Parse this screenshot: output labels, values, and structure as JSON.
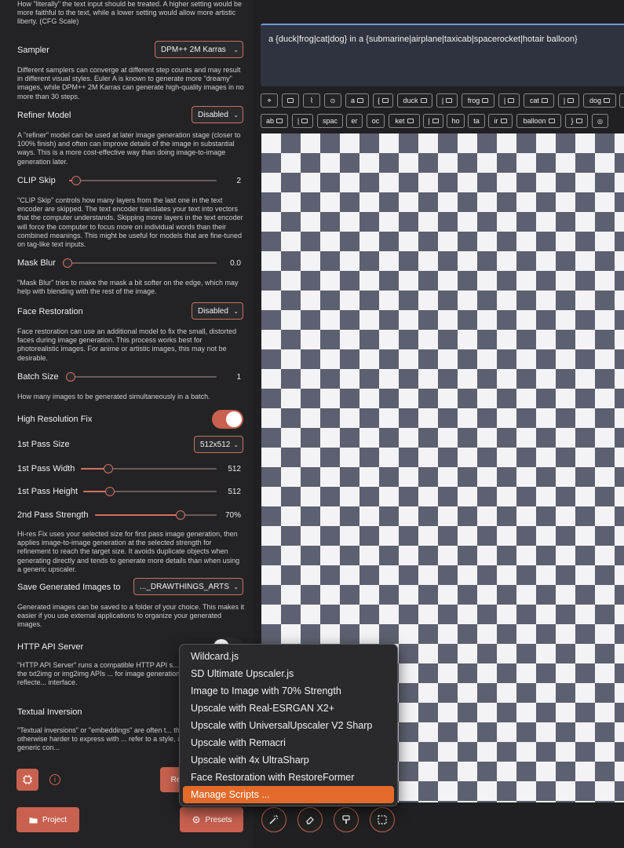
{
  "settings": {
    "cfg_desc_top": "How \"literally\" the text input should be treated. A higher setting would be more faithful to the text, while a lower setting would allow more artistic liberty. (CFG Scale)",
    "sampler": {
      "label": "Sampler",
      "value": "DPM++ 2M Karras",
      "desc": "Different samplers can converge at different step counts and may result in different visual styles. Euler A is known to generate more \"dreamy\" images, while DPM++ 2M Karras can generate high-quality images in no more than 30 steps."
    },
    "refiner": {
      "label": "Refiner Model",
      "value": "Disabled",
      "desc": "A \"refiner\" model can be used at later image generation stage (closer to 100% finish) and often can improve details of the image in substantial ways. This is a more cost-effective way than doing image-to-image generation later."
    },
    "clip_skip": {
      "label": "CLIP Skip",
      "value": "2",
      "fraction": 0.05,
      "desc": "\"CLIP Skip\" controls how many layers from the last one in the text encoder are skipped. The text encoder translates your text into vectors that the computer understands. Skipping more layers in the text encoder will force the computer to focus more on individual words than their combined meanings. This might be useful for models that are fine-tuned on tag-like text inputs."
    },
    "mask_blur": {
      "label": "Mask Blur",
      "value": "0.0",
      "fraction": 0.0,
      "desc": "\"Mask Blur\" tries to make the mask a bit softer on the edge, which may help with blending with the rest of the image."
    },
    "face_restoration": {
      "label": "Face Restoration",
      "value": "Disabled",
      "desc": "Face restoration can use an additional model to fix the small, distorted faces during image generation. This process works best for photorealistic images. For anime or artistic images, this may not be desirable."
    },
    "batch_size": {
      "label": "Batch Size",
      "value": "1",
      "fraction": 0.0,
      "desc": "How many images to be generated simultaneously in a batch."
    },
    "hires_fix": {
      "label": "High Resolution Fix",
      "enabled": true
    },
    "first_pass_size": {
      "label": "1st Pass Size",
      "value": "512x512"
    },
    "first_pass_width": {
      "label": "1st Pass Width",
      "value": "512",
      "fraction": 0.2
    },
    "first_pass_height": {
      "label": "1st Pass Height",
      "value": "512",
      "fraction": 0.2
    },
    "second_pass_strength": {
      "label": "2nd Pass Strength",
      "value": "70%",
      "fraction": 0.7
    },
    "hires_desc": "Hi-res Fix uses your selected size for first pass image generation, then applies image-to-image generation at the selected strength for refinement to reach the target size. It avoids duplicate objects when generating directly and tends to generate more details than when using a generic upscaler.",
    "save_images": {
      "label": "Save Generated Images to",
      "value": "..._DRAWTHINGS_ARTS",
      "desc": "Generated images can be saved to a folder of your choice. This makes it easier if you use external applications to organize your generated images."
    },
    "http_api": {
      "label": "HTTP API Server",
      "enabled": false,
      "desc": "\"HTTP API Server\" runs a compatible HTTP API s... extensions that use the txt2img or img2img APIs ... for image generation. Generations will be reflecte... interface."
    },
    "textual_inversion": {
      "label": "Textual Inversion",
      "desc": "\"Textual inversions\" or \"embeddings\" are often t... things that are otherwise harder to express with ... refer to a style, a character, or some generic con..."
    }
  },
  "bottom": {
    "project_label": "Project",
    "presets_label": "Presets",
    "reset_label": "Re"
  },
  "prompt": {
    "text": "a {duck|frog|cat|dog} in a {submarine|airplane|taxicab|spacerocket|hotair balloon}"
  },
  "chips_row1": [
    "a",
    "{",
    "duck",
    "|",
    "frog",
    "|",
    "cat",
    "|",
    "dog"
  ],
  "chips_row2": [
    "ab",
    "|",
    "spac",
    "er",
    "oc",
    "ket",
    "|",
    "ho",
    "ta",
    "ir",
    "balloon",
    "}"
  ],
  "menu": {
    "items": [
      "Wildcard.js",
      "SD Ultimate Upscaler.js",
      "Image to Image with 70% Strength",
      "Upscale with Real-ESRGAN X2+",
      "Upscale with UniversalUpscaler V2 Sharp",
      "Upscale with Remacri",
      "Upscale with 4x UltraSharp",
      "Face Restoration with RestoreFormer",
      "Manage Scripts ..."
    ],
    "active_index": 8
  },
  "colors": {
    "accent": "#c8614f",
    "menu_highlight": "#e36a2a",
    "prompt_border": "#6f9ae0"
  }
}
